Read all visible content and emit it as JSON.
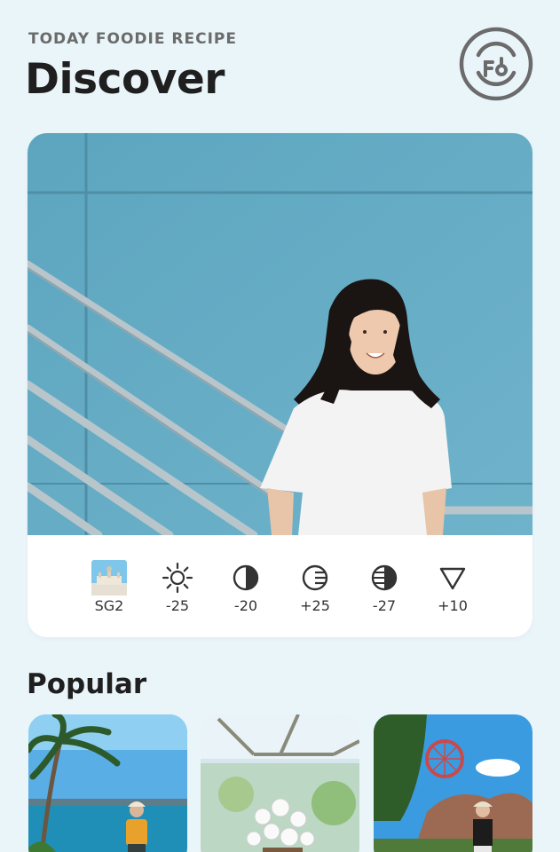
{
  "header": {
    "kicker": "TODAY FOODIE RECIPE",
    "title": "Discover"
  },
  "icons": {
    "logo": "foodie-logo-icon",
    "brightness": "sun-icon",
    "contrast": "half-circle-icon",
    "lines": "striped-circle-icon",
    "shade": "striped-half-circle-icon",
    "vignette": "triangle-down-icon"
  },
  "recipe": {
    "filters": [
      {
        "name": "filter",
        "label": "SG2"
      },
      {
        "name": "brightness",
        "label": "-25"
      },
      {
        "name": "contrast",
        "label": "-20"
      },
      {
        "name": "highlights",
        "label": "+25"
      },
      {
        "name": "shadows",
        "label": "-27"
      },
      {
        "name": "vignette",
        "label": "+10"
      }
    ]
  },
  "popular": {
    "title": "Popular"
  },
  "colors": {
    "background": "#eaf5fa",
    "wall": "#62a9c2",
    "text": "#1f1f1f",
    "muted": "#6b6b6b"
  }
}
